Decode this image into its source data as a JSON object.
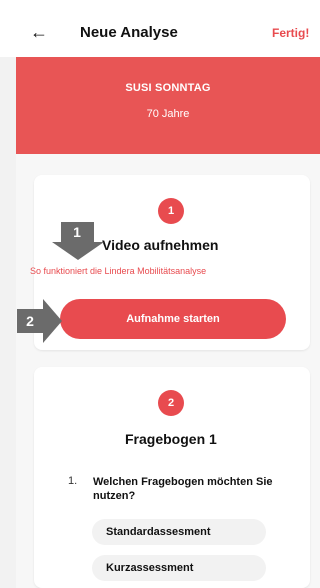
{
  "header": {
    "back_icon": "arrow-left-icon",
    "title": "Neue Analyse",
    "done": "Fertig!"
  },
  "patient": {
    "name": "SUSI SONNTAG",
    "age": "70 Jahre"
  },
  "card1": {
    "step": "1",
    "title": "Video aufnehmen",
    "subtitle": "So funktioniert die Lindera Mobilitätsanalyse",
    "button": "Aufnahme starten"
  },
  "card2": {
    "step": "2",
    "title": "Fragebogen 1",
    "question_number": "1.",
    "question": "Welchen Fragebogen möchten Sie nutzen?",
    "options": [
      "Standardassesment",
      "Kurzassessment"
    ]
  },
  "callouts": {
    "first": "1",
    "second": "2"
  },
  "colors": {
    "accent": "#e84b4f",
    "callout": "#6b6b6b"
  }
}
